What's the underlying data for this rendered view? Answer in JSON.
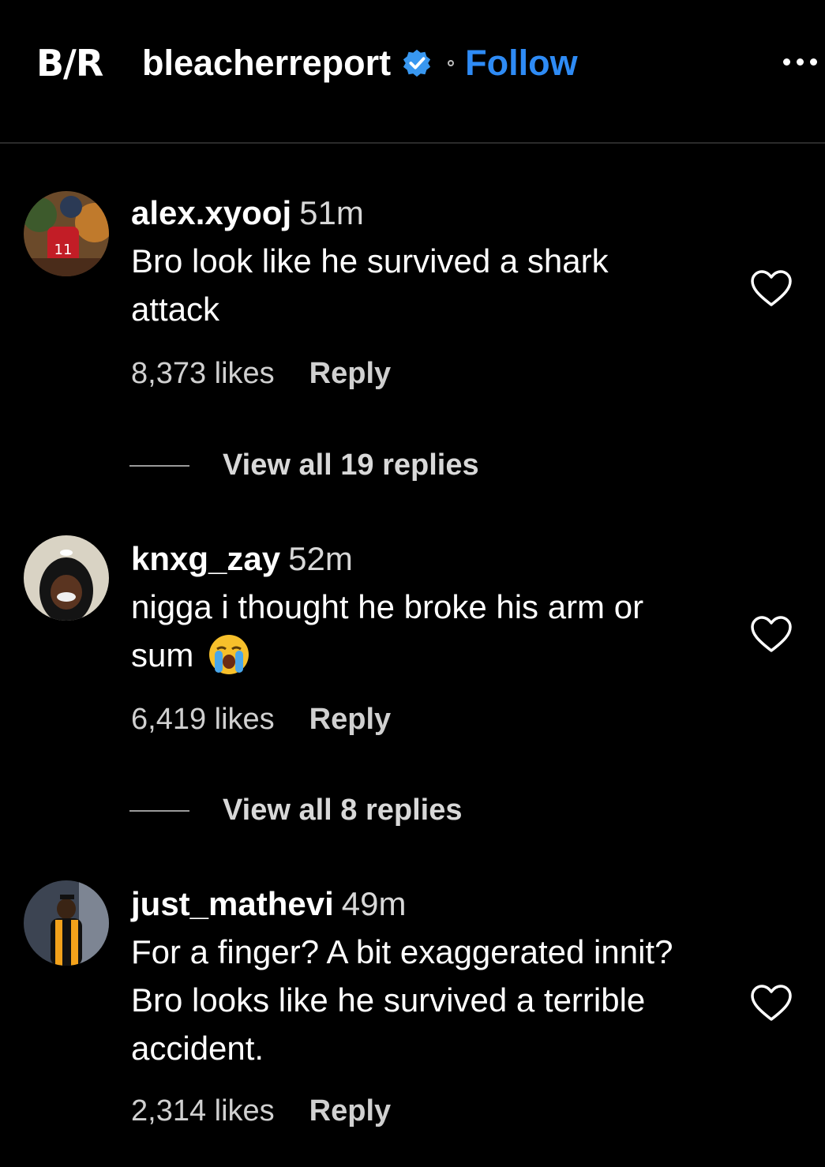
{
  "header": {
    "logo_text": "B/R",
    "account_name": "bleacherreport",
    "follow_label": "Follow",
    "verified_icon": "verified-badge-icon",
    "more_icon": "more-options-icon"
  },
  "comments": [
    {
      "username": "alex.xyooj",
      "time": "51m",
      "text": "Bro look like he survived a shark attack",
      "likes": "8,373 likes",
      "reply_label": "Reply",
      "view_replies": "View all 19 replies"
    },
    {
      "username": "knxg_zay",
      "time": "52m",
      "text": "nigga i thought he broke his arm or sum",
      "emoji": "loudly-crying-face",
      "likes": "6,419 likes",
      "reply_label": "Reply",
      "view_replies": "View all 8 replies"
    },
    {
      "username": "just_mathevi",
      "time": "49m",
      "text": "For a finger? A bit exaggerated innit? Bro looks like he survived a terrible accident.",
      "likes": "2,314 likes",
      "reply_label": "Reply"
    }
  ],
  "colors": {
    "background": "#000000",
    "follow": "#2e8bf5",
    "verified": "#3897f0"
  }
}
